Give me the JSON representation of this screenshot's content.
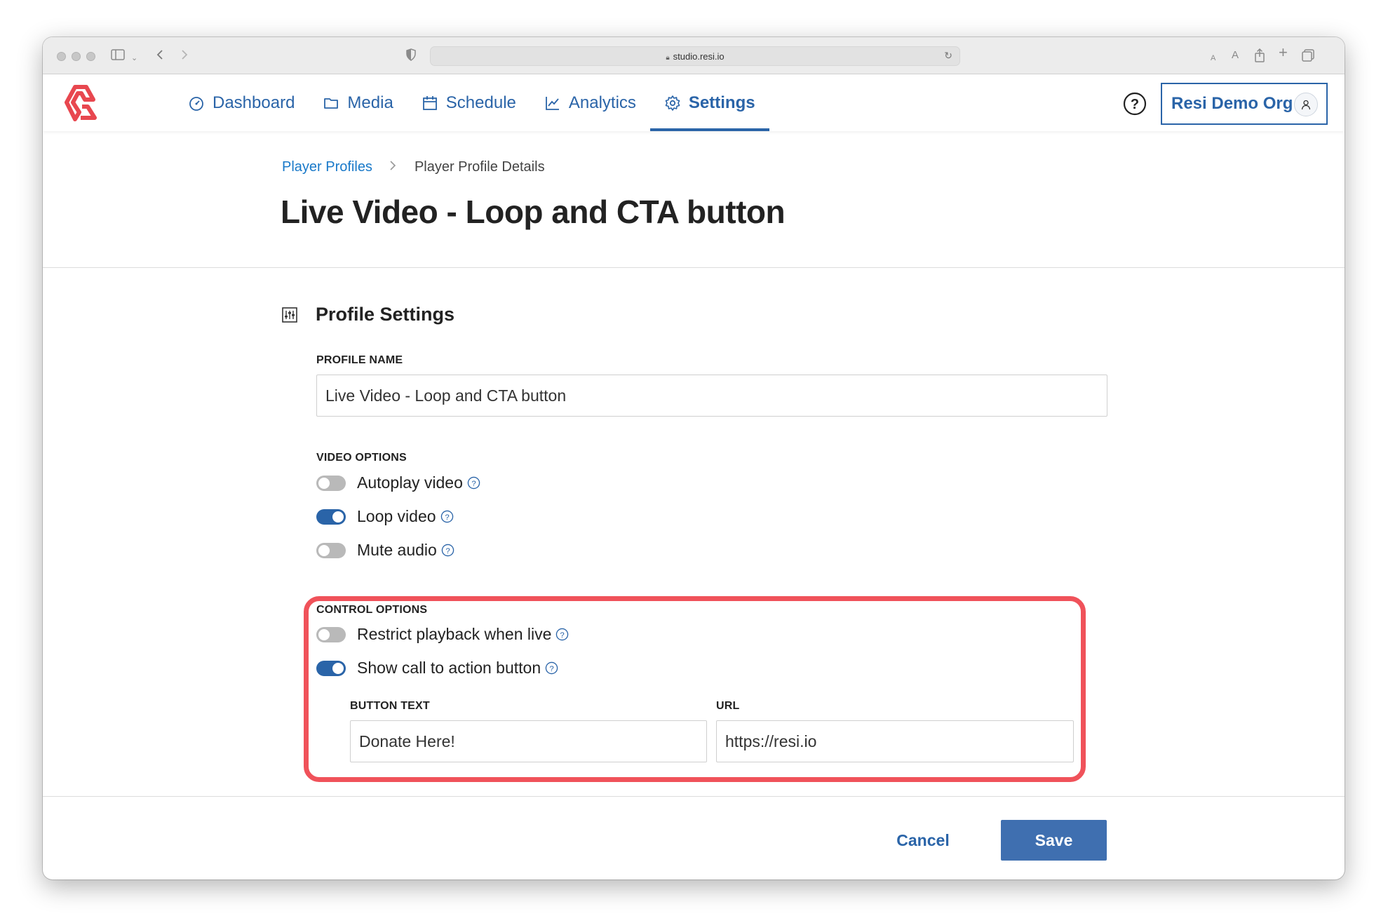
{
  "browser": {
    "url": "studio.resi.io"
  },
  "nav": {
    "items": [
      {
        "label": "Dashboard",
        "icon": "gauge-icon"
      },
      {
        "label": "Media",
        "icon": "folder-icon"
      },
      {
        "label": "Schedule",
        "icon": "calendar-icon"
      },
      {
        "label": "Analytics",
        "icon": "line-chart-icon"
      },
      {
        "label": "Settings",
        "icon": "gear-icon",
        "active": true
      }
    ],
    "org_label": "Resi Demo Org"
  },
  "breadcrumb": {
    "parent": "Player Profiles",
    "current": "Player Profile Details"
  },
  "page": {
    "title": "Live Video - Loop and CTA button"
  },
  "profile_settings": {
    "section_title": "Profile Settings",
    "profile_name_label": "PROFILE NAME",
    "profile_name_value": "Live Video - Loop and CTA button",
    "video_options_label": "VIDEO OPTIONS",
    "video_options": [
      {
        "label": "Autoplay video",
        "enabled": false
      },
      {
        "label": "Loop video",
        "enabled": true
      },
      {
        "label": "Mute audio",
        "enabled": false
      }
    ],
    "control_options_label": "CONTROL OPTIONS",
    "control_options": [
      {
        "label": "Restrict playback when live",
        "enabled": false
      },
      {
        "label": "Show call to action button",
        "enabled": true
      }
    ],
    "button_text_label": "BUTTON TEXT",
    "button_text_value": "Donate Here!",
    "url_label": "URL",
    "url_value": "https://resi.io"
  },
  "actions": {
    "cancel_label": "Cancel",
    "save_label": "Save"
  },
  "colors": {
    "accent": "#2a64a8",
    "link": "#1979c9",
    "highlight": "#f0525a",
    "logo": "#e8474f"
  }
}
